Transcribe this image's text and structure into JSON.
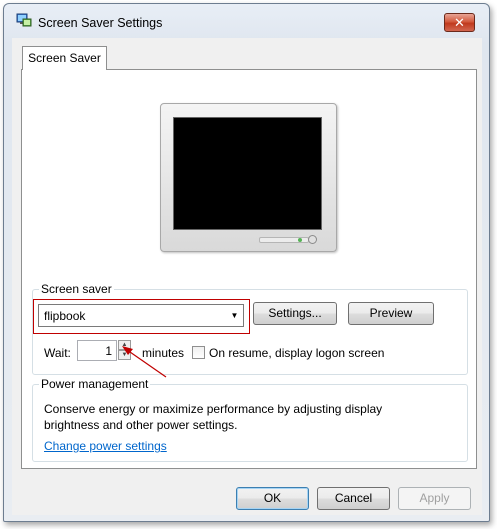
{
  "window": {
    "title": "Screen Saver Settings",
    "close_glyph": "✕"
  },
  "tabs": [
    {
      "label": "Screen Saver"
    }
  ],
  "screen_saver": {
    "group_label": "Screen saver",
    "selected": "flipbook",
    "settings_label": "Settings...",
    "preview_label": "Preview",
    "wait_label": "Wait:",
    "wait_value": "1",
    "minutes_label": "minutes",
    "on_resume_label": "On resume, display logon screen",
    "on_resume_checked": false
  },
  "power_management": {
    "group_label": "Power management",
    "description": "Conserve energy or maximize performance by adjusting display brightness and other power settings.",
    "link": "Change power settings"
  },
  "footer": {
    "ok_label": "OK",
    "cancel_label": "Cancel",
    "apply_label": "Apply"
  },
  "colors": {
    "annotation": "#c00000",
    "link": "#0066cc"
  }
}
